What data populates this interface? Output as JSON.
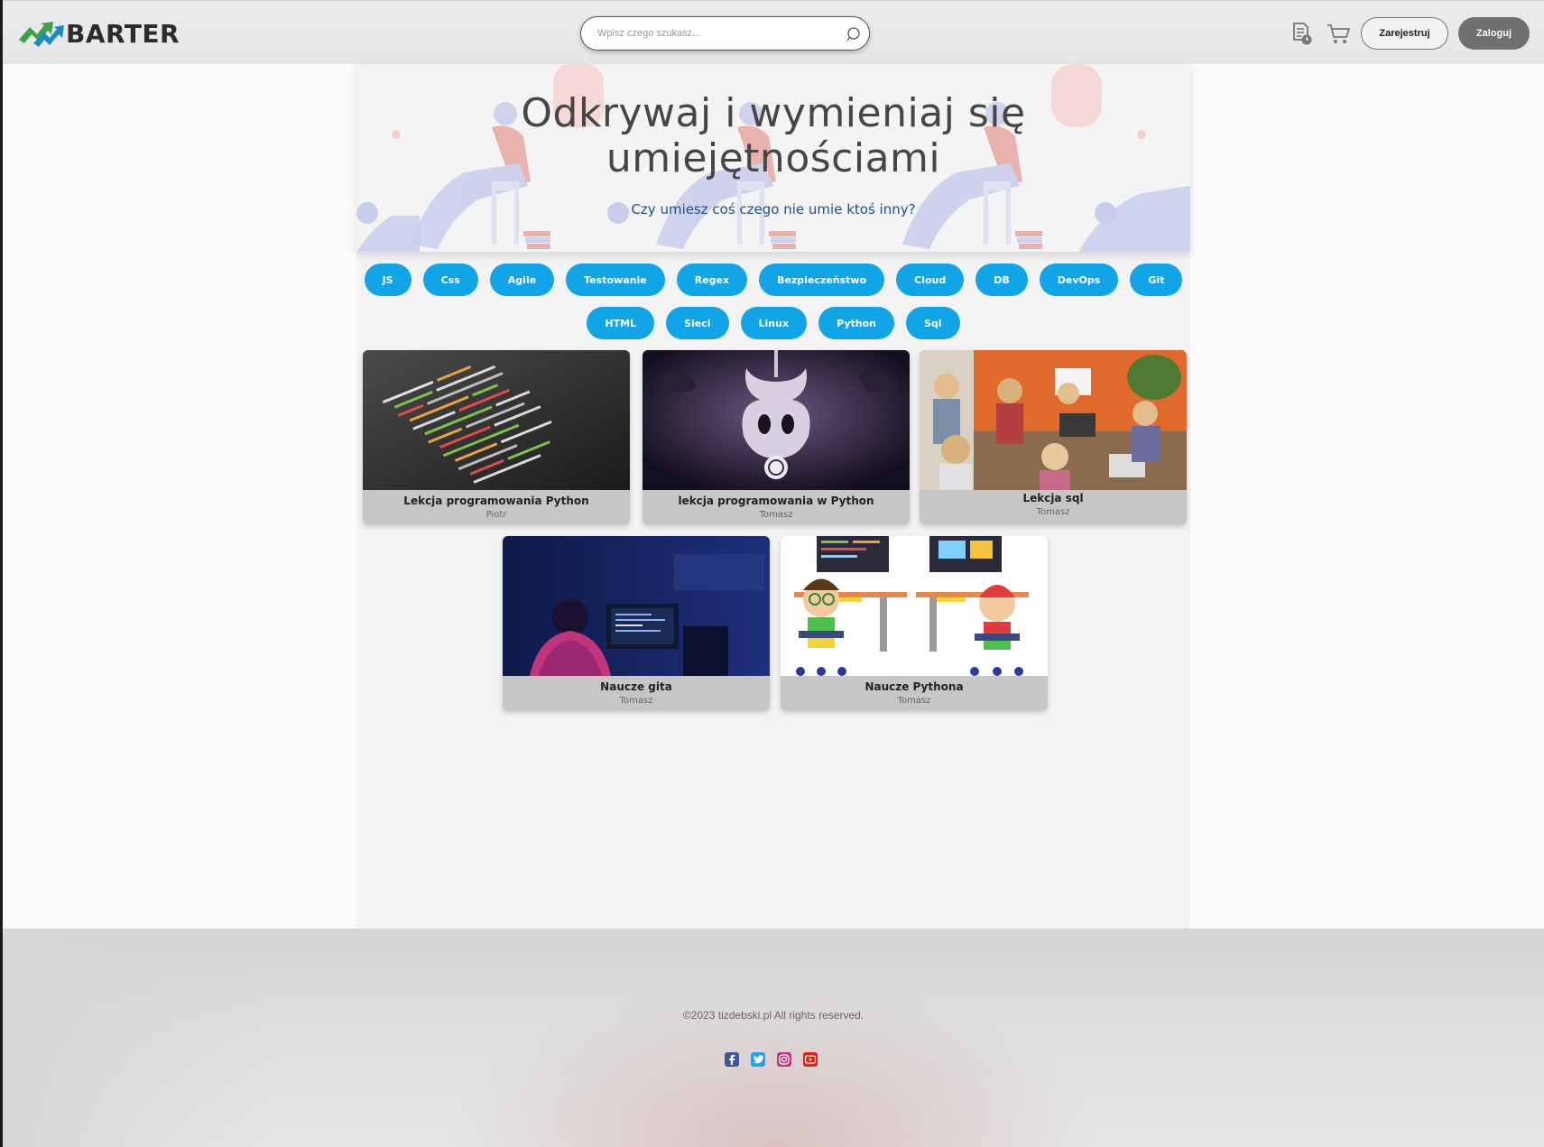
{
  "header": {
    "logo_text": "BARTER",
    "search_placeholder": "Wpisz czego szukasz...",
    "register_label": "Zarejestruj",
    "login_label": "Zaloguj",
    "icons": [
      "document-clock-icon",
      "cart-icon",
      "search-icon"
    ]
  },
  "hero": {
    "title_line1": "Odkrywaj i wymieniaj się",
    "title_line2": "umiejętnościami",
    "subtitle": "Czy umiesz coś czego nie umie ktoś inny?"
  },
  "tags": [
    "JS",
    "Css",
    "Agile",
    "Testowanie",
    "Regex",
    "Bezpieczeństwo",
    "Cloud",
    "DB",
    "DevOps",
    "Git",
    "HTML",
    "Sieci",
    "Linux",
    "Python",
    "Sql"
  ],
  "cards": [
    {
      "title": "Lekcja programowania Python",
      "author": "Piotr"
    },
    {
      "title": "lekcja programowania w Python",
      "author": "Tomasz"
    },
    {
      "title": "Lekcja sql",
      "author": "Tomasz"
    },
    {
      "title": "Naucze gita",
      "author": "Tomasz"
    },
    {
      "title": "Naucze Pythona",
      "author": "Tomasz"
    }
  ],
  "footer": {
    "copyright": "©2023 tizdebski.pl All rights reserved.",
    "socials": [
      "facebook-icon",
      "twitter-icon",
      "instagram-icon",
      "youtube-icon"
    ]
  },
  "colors": {
    "tag_blue": "#11a4e6",
    "subtitle_blue": "#1f4f8a",
    "login_gray": "#707070",
    "facebook": "#3b5998",
    "twitter": "#1da1f2",
    "instagram": "#c13584",
    "youtube": "#e62117"
  }
}
